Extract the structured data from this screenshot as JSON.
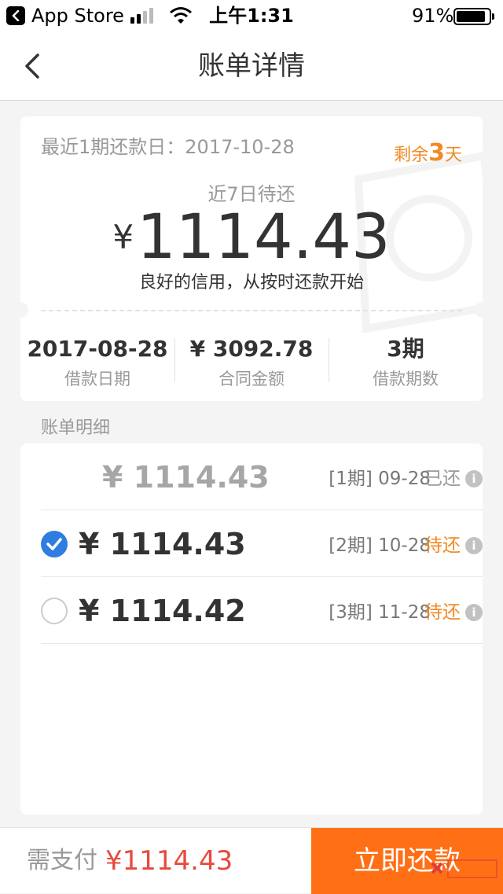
{
  "status_bar": {
    "back_app": "App Store",
    "time": "上午1:31",
    "battery": "91%",
    "battery_level": 0.91
  },
  "nav": {
    "title": "账单详情"
  },
  "summary": {
    "recent_repay_label": "最近1期还款日：",
    "recent_repay_date": "2017-10-28",
    "remaining_prefix": "剩余",
    "remaining_days": "3",
    "remaining_suffix": "天",
    "due_label": "近7日待还",
    "due_currency": "¥",
    "due_amount": "1114.43",
    "slogan": "良好的信用，从按时还款开始",
    "stats": [
      {
        "value": "2017-08-28",
        "label": "借款日期"
      },
      {
        "value": "¥ 3092.78",
        "label": "合同金额"
      },
      {
        "value": "3期",
        "label": "借款期数"
      }
    ]
  },
  "bill_section_title": "账单明细",
  "bills": [
    {
      "amount": "¥ 1114.43",
      "period": "[1期] 09-28",
      "status": "已还",
      "state": "paid"
    },
    {
      "amount": "¥ 1114.43",
      "period": "[2期] 10-28",
      "status": "待还",
      "state": "selected"
    },
    {
      "amount": "¥ 1114.42",
      "period": "[3期] 11-28",
      "status": "待还",
      "state": "unselected"
    }
  ],
  "footer": {
    "pay_label": "需支付",
    "pay_amount": "¥1114.43",
    "repay_button": "立即还款"
  },
  "colors": {
    "accent_orange": "#ff7016",
    "pending_orange": "#f08a24",
    "amount_red": "#e84a3d",
    "check_blue": "#2f7de1"
  },
  "icons": [
    "app-store-back-icon",
    "signal-icon",
    "wifi-icon",
    "battery-icon",
    "back-arrow-icon",
    "checkmark-icon",
    "info-icon"
  ]
}
